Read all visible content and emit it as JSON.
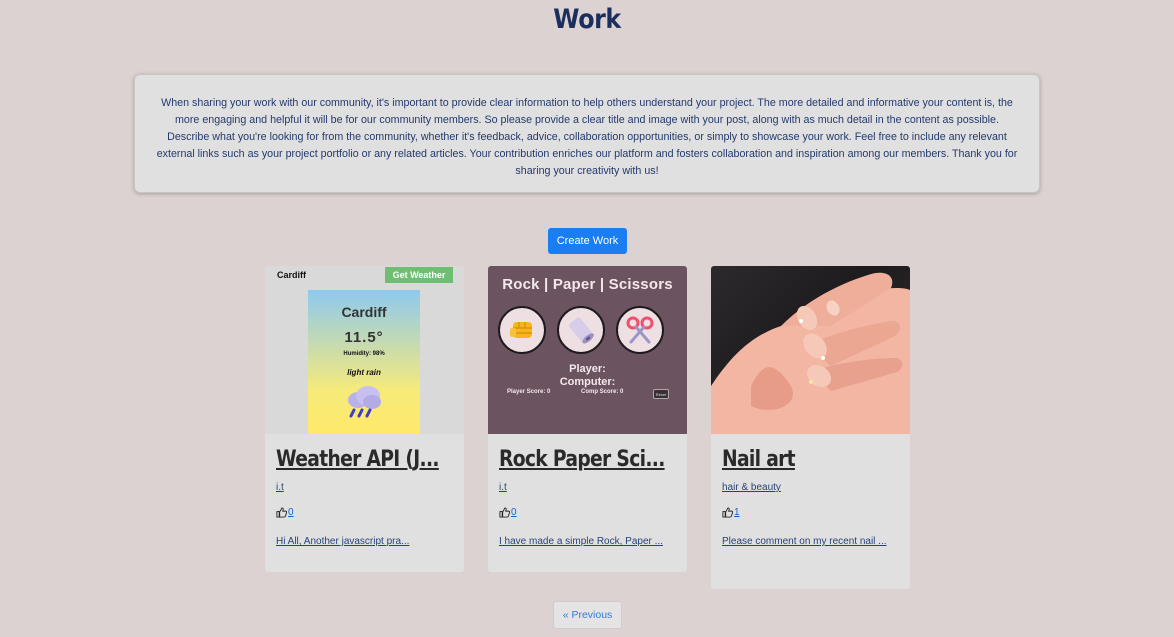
{
  "page": {
    "title": "Work",
    "intro": "When sharing your work with our community, it's important to provide clear information to help others understand your project. The more detailed and informative your content is, the more engaging and helpful it will be for our community members. So please provide a clear title and image with your post, along with as much detail in the content as possible. Describe what you're looking for from the community, whether it's feedback, advice, collaboration opportunities, or simply to showcase your work. Feel free to include any relevant external links such as your project portfolio or any related articles. Your contribution enriches our platform and fosters collaboration and inspiration among our members. Thank you for sharing your creativity with us!",
    "create_button": "Create Work",
    "previous_button": "« Previous"
  },
  "cards": [
    {
      "title": "Weather API (J...",
      "category": "i.t",
      "likes": "0",
      "excerpt": "Hi All, Another javascript pra...",
      "thumb": {
        "city_small": "Cardiff",
        "button": "Get Weather",
        "city": "Cardiff",
        "temp": "11.5°",
        "humidity": "Humidity: 98%",
        "desc": "light rain"
      }
    },
    {
      "title": "Rock Paper Sci...",
      "category": "i.t",
      "likes": "0",
      "excerpt": "I have made a simple Rock, Paper ...",
      "thumb": {
        "title": "Rock | Paper | Scissors",
        "player": "Player:",
        "computer": "Computer:",
        "player_score": "Player Score: 0",
        "comp_score": "Comp Score: 0",
        "reset": "Reset"
      }
    },
    {
      "title": "Nail art",
      "category": "hair & beauty",
      "likes": "1",
      "excerpt": "Please comment on my recent nail ..."
    }
  ],
  "colors": {
    "background": "#dcd2d2",
    "title": "#1b2f5e",
    "accent": "#1a7ef2",
    "card": "#e1e0e0"
  }
}
